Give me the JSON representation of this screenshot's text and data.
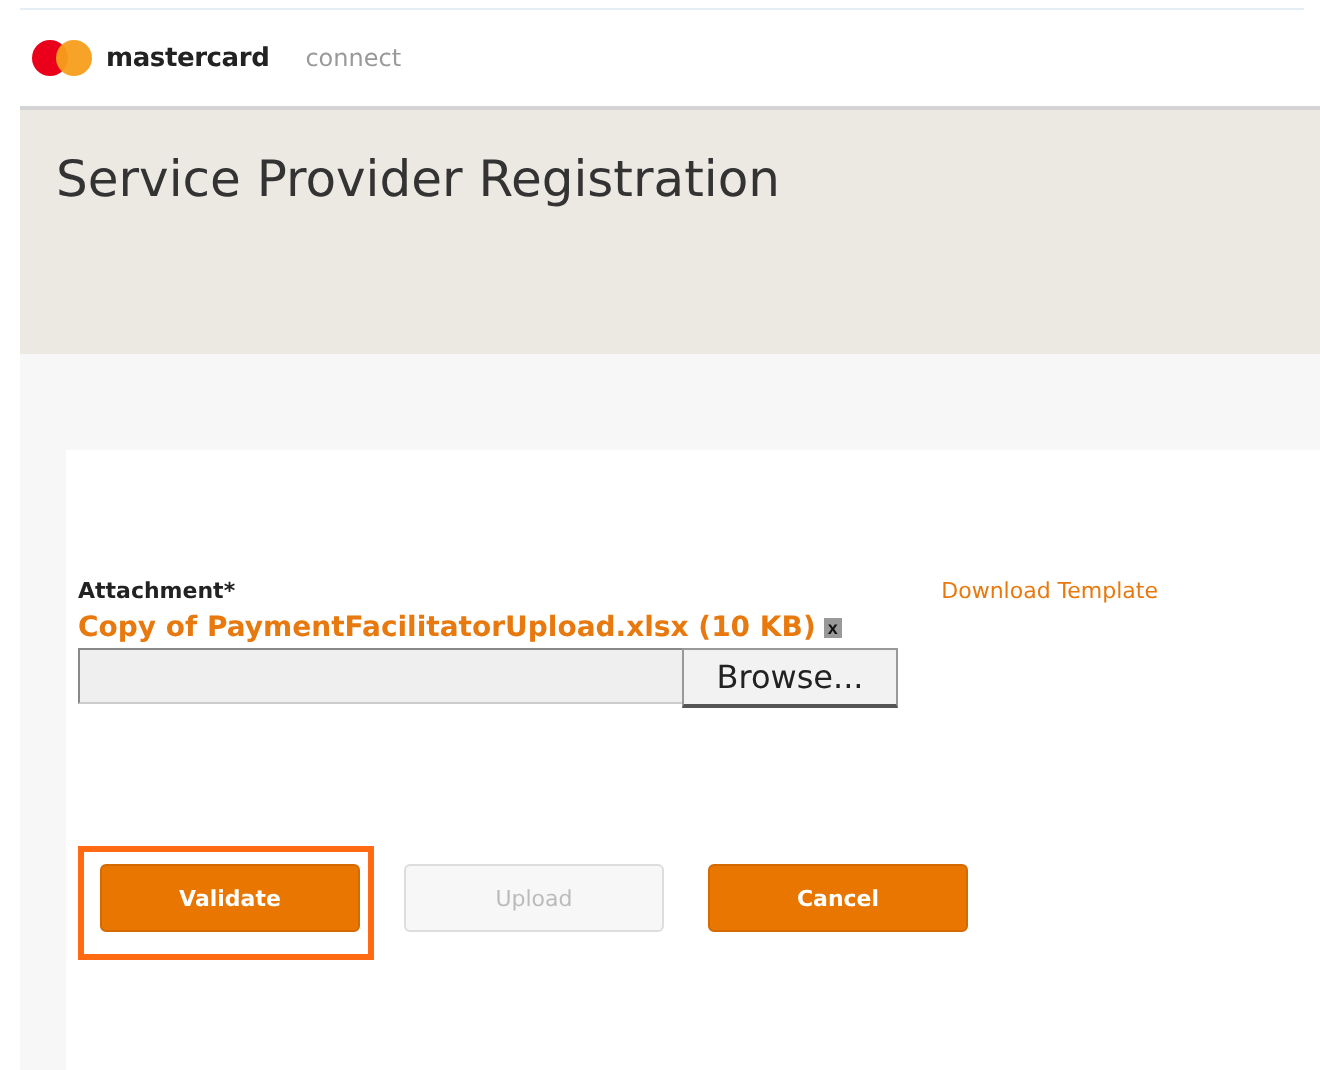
{
  "header": {
    "brand": "mastercard",
    "product": "connect"
  },
  "page_title": "Service Provider Registration",
  "form": {
    "attachment_label": "Attachment*",
    "download_link": "Download Template",
    "file_name": "Copy of PaymentFacilitatorUpload.xlsx (10 KB)",
    "remove_label": "x",
    "browse_button": "Browse..."
  },
  "buttons": [
    {
      "label": "Validate",
      "disabled": false,
      "highlighted": true
    },
    {
      "label": "Upload",
      "disabled": true,
      "highlighted": false
    },
    {
      "label": "Cancel",
      "disabled": false,
      "highlighted": false
    }
  ]
}
